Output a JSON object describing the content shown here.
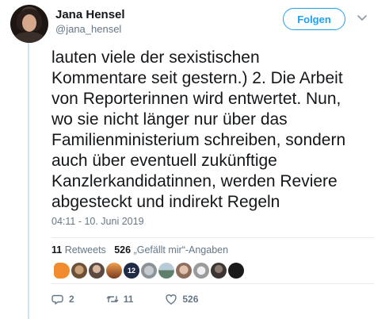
{
  "author": {
    "name": "Jana Hensel",
    "handle": "@jana_hensel"
  },
  "follow_label": "Folgen",
  "tweet": {
    "text": "lauten viele der sexistischen\nKommentare seit gestern.) 2. Die Arbeit\nvon Reporterinnen wird entwertet. Nun,\nwo sie nicht länger nur über das\nFamilienministerium schreiben, sondern\nauch über eventuell zukünftige\nKanzlerkandidatinnen, werden Reviere\nabgesteckt und indirekt Regeln",
    "timestamp": "04:11 - 10. Juni 2019"
  },
  "stats": {
    "retweets_count": "11",
    "retweets_label": "Retweets",
    "likes_count": "526",
    "likes_label": "„Gefällt mir“-Angaben"
  },
  "likers": [
    {
      "icon": "orange-hand-avatar",
      "color": "#f28b2e"
    },
    {
      "icon": "dog-avatar",
      "color": "#8b6b4a"
    },
    {
      "icon": "person-avatar",
      "color": "#6d5a50"
    },
    {
      "icon": "sunset-avatar",
      "color": "#c86a2c"
    },
    {
      "icon": "jersey-12-avatar",
      "color": "#1f2a44"
    },
    {
      "icon": "grey-avatar",
      "color": "#9aa3a8"
    },
    {
      "icon": "landscape-avatar",
      "color": "#6e8f7a"
    },
    {
      "icon": "face-avatar",
      "color": "#b99a86"
    },
    {
      "icon": "bw-avatar",
      "color": "#cfcfcf"
    },
    {
      "icon": "dark-avatar",
      "color": "#3a3532"
    },
    {
      "icon": "black-avatar",
      "color": "#1a1a1a"
    }
  ],
  "actions": {
    "reply_count": "2",
    "retweet_count": "11",
    "like_count": "526"
  },
  "colors": {
    "accent": "#1da1f2",
    "secondary_text": "#657786",
    "thread_line": "#cfe3f5"
  }
}
